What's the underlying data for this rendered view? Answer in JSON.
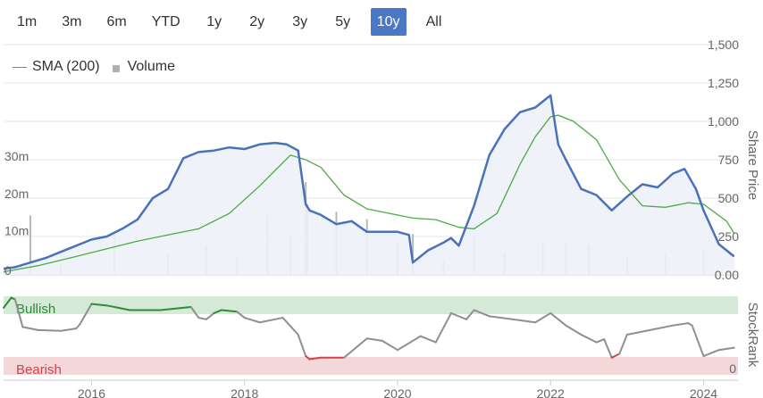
{
  "range_selector": {
    "buttons": [
      "1m",
      "3m",
      "6m",
      "YTD",
      "1y",
      "2y",
      "3y",
      "5y",
      "10y",
      "All"
    ],
    "active": "10y"
  },
  "legend": {
    "sma_label": "SMA (200)",
    "volume_label": "Volume"
  },
  "colors": {
    "price": "#4a72b8",
    "sma": "#4daa44",
    "volume": "#b8b8b8",
    "bullish": "#2f8a3a",
    "bearish": "#d0434b",
    "neutral": "#8f8f8f"
  },
  "chart_data": [
    {
      "type": "line",
      "y_title": "Share Price",
      "x_ticks": [
        "2016",
        "2018",
        "2020",
        "2022",
        "2024"
      ],
      "price_ticks": [
        "0.00",
        "250",
        "500",
        "750",
        "1,000",
        "1,250",
        "1,500"
      ],
      "price_ylim": [
        0,
        1500
      ],
      "volume_ticks": [
        "0",
        "10m",
        "20m",
        "30m"
      ],
      "volume_ylim": [
        0,
        50000000
      ],
      "grid": true,
      "series": [
        {
          "name": "Share Price",
          "x": [
            2014.85,
            2015.0,
            2015.2,
            2015.4,
            2015.6,
            2015.8,
            2016.0,
            2016.2,
            2016.4,
            2016.6,
            2016.8,
            2017.0,
            2017.2,
            2017.4,
            2017.6,
            2017.8,
            2018.0,
            2018.2,
            2018.4,
            2018.55,
            2018.7,
            2018.8,
            2018.85,
            2019.0,
            2019.2,
            2019.4,
            2019.6,
            2019.8,
            2020.0,
            2020.15,
            2020.2,
            2020.4,
            2020.6,
            2020.7,
            2020.8,
            2021.0,
            2021.2,
            2021.4,
            2021.6,
            2021.8,
            2021.9,
            2022.0,
            2022.1,
            2022.2,
            2022.4,
            2022.6,
            2022.8,
            2023.0,
            2023.2,
            2023.4,
            2023.6,
            2023.75,
            2023.9,
            2024.0,
            2024.2,
            2024.4
          ],
          "values": [
            40,
            50,
            80,
            110,
            150,
            190,
            230,
            250,
            300,
            360,
            500,
            560,
            760,
            800,
            810,
            830,
            820,
            850,
            860,
            850,
            810,
            460,
            420,
            390,
            330,
            350,
            280,
            280,
            280,
            260,
            80,
            160,
            210,
            240,
            190,
            450,
            780,
            950,
            1060,
            1090,
            1130,
            1170,
            850,
            750,
            560,
            520,
            420,
            510,
            590,
            570,
            660,
            690,
            560,
            420,
            200,
            120
          ]
        },
        {
          "name": "SMA (200)",
          "x": [
            2014.85,
            2015.3,
            2015.8,
            2016.2,
            2016.6,
            2017.0,
            2017.4,
            2017.8,
            2018.2,
            2018.4,
            2018.6,
            2018.8,
            2019.0,
            2019.3,
            2019.6,
            2019.9,
            2020.2,
            2020.5,
            2020.8,
            2021.0,
            2021.3,
            2021.6,
            2021.8,
            2022.0,
            2022.1,
            2022.3,
            2022.6,
            2022.9,
            2023.2,
            2023.5,
            2023.8,
            2024.0,
            2024.3,
            2024.4
          ],
          "values": [
            20,
            60,
            120,
            170,
            220,
            260,
            300,
            400,
            580,
            680,
            780,
            750,
            700,
            520,
            430,
            400,
            370,
            360,
            310,
            300,
            400,
            720,
            900,
            1030,
            1040,
            1000,
            880,
            620,
            450,
            440,
            470,
            460,
            350,
            270
          ]
        }
      ],
      "volume": {
        "x": [
          2015.2,
          2015.6,
          2016.3,
          2017.0,
          2017.5,
          2017.9,
          2018.3,
          2018.6,
          2018.8,
          2018.82,
          2019.2,
          2019.6,
          2020.0,
          2020.2,
          2020.6,
          2021.0,
          2021.4,
          2021.9,
          2022.2,
          2022.5,
          2023.0,
          2023.5,
          2024.0
        ],
        "values": [
          16000000,
          3000000,
          11000000,
          6000000,
          8000000,
          5000000,
          16000000,
          10000000,
          25000000,
          19000000,
          17000000,
          15000000,
          9000000,
          11000000,
          4000000,
          10000000,
          6000000,
          9000000,
          9000000,
          8000000,
          5000000,
          6000000,
          7000000
        ]
      }
    },
    {
      "type": "line",
      "y_title": "StockRank",
      "zones": [
        "Bullish",
        "Bearish"
      ],
      "ticks": [
        "0"
      ],
      "ylim": [
        0,
        100
      ],
      "series": [
        {
          "name": "StockRank",
          "x": [
            2014.85,
            2014.95,
            2015.0,
            2015.1,
            2015.3,
            2015.6,
            2015.8,
            2015.85,
            2016.0,
            2016.2,
            2016.5,
            2016.9,
            2017.3,
            2017.4,
            2017.5,
            2017.6,
            2017.7,
            2017.9,
            2018.0,
            2018.2,
            2018.5,
            2018.7,
            2018.8,
            2018.85,
            2019.0,
            2019.3,
            2019.6,
            2019.8,
            2020.0,
            2020.3,
            2020.5,
            2020.7,
            2020.9,
            2021.0,
            2021.2,
            2021.5,
            2021.8,
            2022.0,
            2022.2,
            2022.4,
            2022.6,
            2022.7,
            2022.8,
            2022.9,
            2023.0,
            2023.3,
            2023.6,
            2023.8,
            2023.85,
            2024.0,
            2024.2,
            2024.4
          ],
          "values": [
            85,
            98,
            96,
            60,
            56,
            55,
            58,
            64,
            90,
            88,
            82,
            82,
            86,
            72,
            70,
            78,
            82,
            80,
            72,
            66,
            72,
            50,
            22,
            18,
            20,
            20,
            45,
            42,
            30,
            48,
            40,
            78,
            70,
            82,
            74,
            70,
            66,
            78,
            62,
            50,
            40,
            44,
            20,
            25,
            50,
            56,
            62,
            65,
            62,
            22,
            30,
            33
          ]
        }
      ]
    }
  ]
}
